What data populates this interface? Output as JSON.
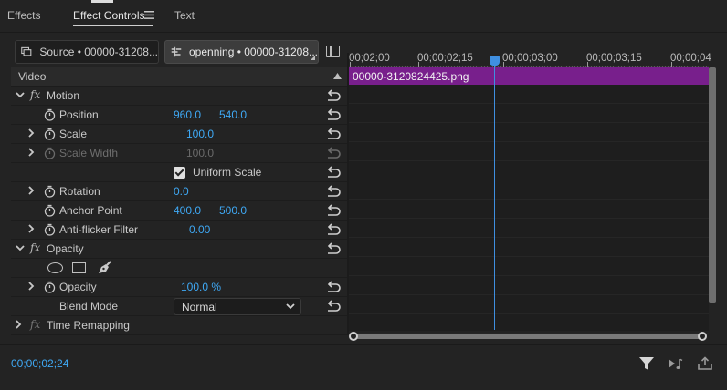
{
  "tabs": [
    {
      "label": "Effects"
    },
    {
      "label": "Effect Controls",
      "menu_icon": "hamburger-icon",
      "active": true
    },
    {
      "label": "Text"
    }
  ],
  "source": {
    "source_label": "Source • 00000-31208...",
    "sequence_label": "openning • 00000-31208..."
  },
  "section_header": "Video",
  "effects": {
    "motion": {
      "label": "Motion",
      "position": {
        "label": "Position",
        "x": "960.0",
        "y": "540.0"
      },
      "scale": {
        "label": "Scale",
        "value": "100.0"
      },
      "scale_width": {
        "label": "Scale Width",
        "value": "100.0"
      },
      "uniform_scale": {
        "label": "Uniform Scale",
        "checked": true
      },
      "rotation": {
        "label": "Rotation",
        "value": "0.0"
      },
      "anchor_point": {
        "label": "Anchor Point",
        "x": "400.0",
        "y": "500.0"
      },
      "anti_flicker": {
        "label": "Anti-flicker Filter",
        "value": "0.00"
      }
    },
    "opacity": {
      "label": "Opacity",
      "opacity_prop": {
        "label": "Opacity",
        "value": "100.0 %"
      },
      "blend_mode": {
        "label": "Blend Mode",
        "value": "Normal"
      }
    },
    "time_remapping": {
      "label": "Time Remapping"
    }
  },
  "timeline": {
    "ruler_labels": [
      "00;02;00",
      "00;00;02;15",
      "00;00;03;00",
      "00;00;03;15",
      "00;00;04"
    ],
    "clip_name": "00000-3120824425.png"
  },
  "footer": {
    "timecode": "00;00;02;24"
  },
  "colors": {
    "value_blue": "#3fa9f5",
    "clip_purple": "#781f8c",
    "playhead": "#3f8fe0"
  }
}
